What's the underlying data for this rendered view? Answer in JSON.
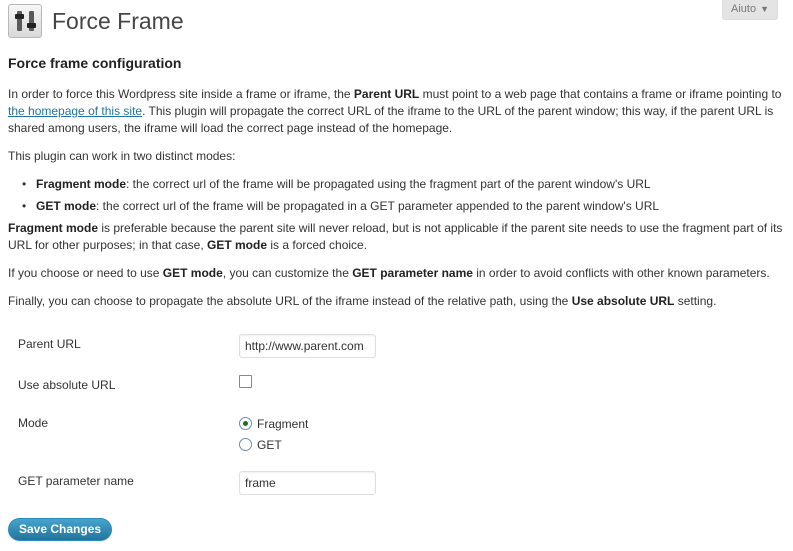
{
  "header": {
    "title": "Force Frame",
    "icon": "plugin-settings-icon"
  },
  "help_tab": {
    "label": "Aiuto",
    "arrow": "▼"
  },
  "section_title": "Force frame configuration",
  "intro": {
    "p1_a": "In order to force this Wordpress site inside a frame or iframe, the ",
    "p1_b": "Parent URL",
    "p1_c": " must point to a web page that contains a frame or iframe pointing to ",
    "p1_link": "the homepage of this site",
    "p1_d": ". This plugin will propagate the correct URL of the iframe to the URL of the parent window; this way, if the parent URL is shared among users, the iframe will load the correct page instead of the homepage.",
    "p2": "This plugin can work in two distinct modes:",
    "li1_b": "Fragment mode",
    "li1_t": ": the correct url of the frame will be propagated using the fragment part of the parent window's URL",
    "li2_b": "GET mode",
    "li2_t": ": the correct url of the frame will be propagated in a GET parameter appended to the parent window's URL",
    "p3_b1": "Fragment mode",
    "p3_t1": " is preferable because the parent site will never reload, but is not applicable if the parent site needs to use the fragment part of its URL for other purposes; in that case, ",
    "p3_b2": "GET mode",
    "p3_t2": " is a forced choice.",
    "p4_t1": "If you choose or need to use ",
    "p4_b1": "GET mode",
    "p4_t2": ", you can customize the ",
    "p4_b2": "GET parameter name",
    "p4_t3": " in order to avoid conflicts with other known parameters.",
    "p5_t1": "Finally, you can choose to propagate the absolute URL of the iframe instead of the relative path, using the ",
    "p5_b1": "Use absolute URL",
    "p5_t2": " setting."
  },
  "form": {
    "parent_url": {
      "label": "Parent URL",
      "value": "http://www.parent.com"
    },
    "use_absolute_url": {
      "label": "Use absolute URL",
      "checked": false
    },
    "mode": {
      "label": "Mode",
      "options": [
        "Fragment",
        "GET"
      ],
      "selected": "Fragment"
    },
    "get_param": {
      "label": "GET parameter name",
      "value": "frame"
    }
  },
  "save_button": {
    "label": "Save Changes"
  },
  "colors": {
    "link": "#21759b",
    "button": "#21759b",
    "title": "#464646"
  }
}
